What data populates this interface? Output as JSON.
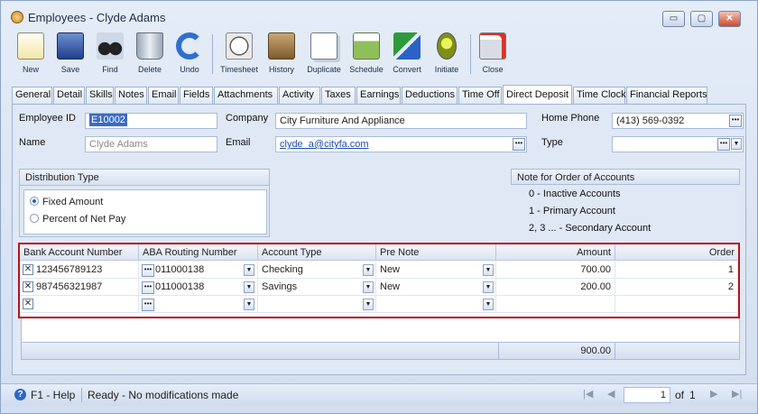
{
  "window": {
    "title": "Employees - Clyde Adams"
  },
  "toolbar": {
    "buttons": [
      {
        "label": "New",
        "icon": "new-doc-icon"
      },
      {
        "label": "Save",
        "icon": "floppy-disk-icon"
      },
      {
        "label": "Find",
        "icon": "binoculars-icon"
      },
      {
        "label": "Delete",
        "icon": "trash-bin-icon"
      },
      {
        "label": "Undo",
        "icon": "undo-arrow-icon"
      },
      {
        "label": "Timesheet",
        "icon": "clock-sheet-icon"
      },
      {
        "label": "History",
        "icon": "history-icon"
      },
      {
        "label": "Duplicate",
        "icon": "duplicate-icon"
      },
      {
        "label": "Schedule",
        "icon": "schedule-icon"
      },
      {
        "label": "Convert",
        "icon": "convert-arrows-icon"
      },
      {
        "label": "Initiate",
        "icon": "traffic-light-icon"
      },
      {
        "label": "Close",
        "icon": "close-window-icon"
      }
    ]
  },
  "tabs": [
    "General",
    "Detail",
    "Skills",
    "Notes",
    "Email",
    "Fields",
    "Attachments",
    "Activity",
    "Taxes",
    "Earnings",
    "Deductions",
    "Time Off",
    "Direct Deposit",
    "Time Clock",
    "Financial Reports"
  ],
  "active_tab": "Direct Deposit",
  "form": {
    "employee_id_label": "Employee ID",
    "employee_id": "E10002",
    "name_label": "Name",
    "name": "Clyde Adams",
    "company_label": "Company",
    "company": "City Furniture And Appliance",
    "email_label": "Email",
    "email": "clyde_a@cityfa.com",
    "home_phone_label": "Home Phone",
    "home_phone": "(413) 569-0392",
    "type_label": "Type",
    "type": ""
  },
  "distribution": {
    "title": "Distribution Type",
    "options": [
      "Fixed Amount",
      "Percent of Net Pay"
    ],
    "selected": "Fixed Amount"
  },
  "note": {
    "title": "Note for Order of Accounts",
    "lines": [
      "0 - Inactive Accounts",
      "1 - Primary Account",
      "2, 3 ... - Secondary Account"
    ]
  },
  "grid": {
    "columns": [
      "Bank Account Number",
      "ABA Routing Number",
      "Account Type",
      "Pre Note",
      "Amount",
      "Order"
    ],
    "rows": [
      {
        "account": "123456789123",
        "routing": "011000138",
        "type": "Checking",
        "prenote": "New",
        "amount": "700.00",
        "order": "1"
      },
      {
        "account": "987456321987",
        "routing": "011000138",
        "type": "Savings",
        "prenote": "New",
        "amount": "200.00",
        "order": "2"
      },
      {
        "account": "",
        "routing": "",
        "type": "",
        "prenote": "",
        "amount": "",
        "order": ""
      }
    ],
    "total_amount": "900.00"
  },
  "status": {
    "help": "F1 - Help",
    "message": "Ready - No modifications made",
    "page": "1",
    "of_label": "of",
    "total_pages": "1"
  }
}
